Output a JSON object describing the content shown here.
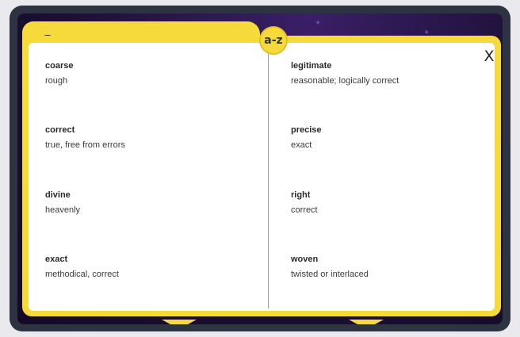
{
  "header": {
    "badge_label": "a-z",
    "close_label": "X"
  },
  "glossary": {
    "left": [
      {
        "term": "coarse",
        "definition": "rough"
      },
      {
        "term": "correct",
        "definition": "true, free from errors"
      },
      {
        "term": "divine",
        "definition": "heavenly"
      },
      {
        "term": "exact",
        "definition": "methodical, correct"
      }
    ],
    "right": [
      {
        "term": "legitimate",
        "definition": "reasonable; logically correct"
      },
      {
        "term": "precise",
        "definition": "exact"
      },
      {
        "term": "right",
        "definition": "correct"
      },
      {
        "term": "woven",
        "definition": "twisted or interlaced"
      }
    ]
  },
  "icons": {
    "corner": "sun-icon",
    "badge": "az-icon",
    "close": "close-icon"
  },
  "colors": {
    "frame": "#f6d93b",
    "background": "#1b0f33",
    "device": "#2d3341",
    "panel": "#ffffff"
  }
}
